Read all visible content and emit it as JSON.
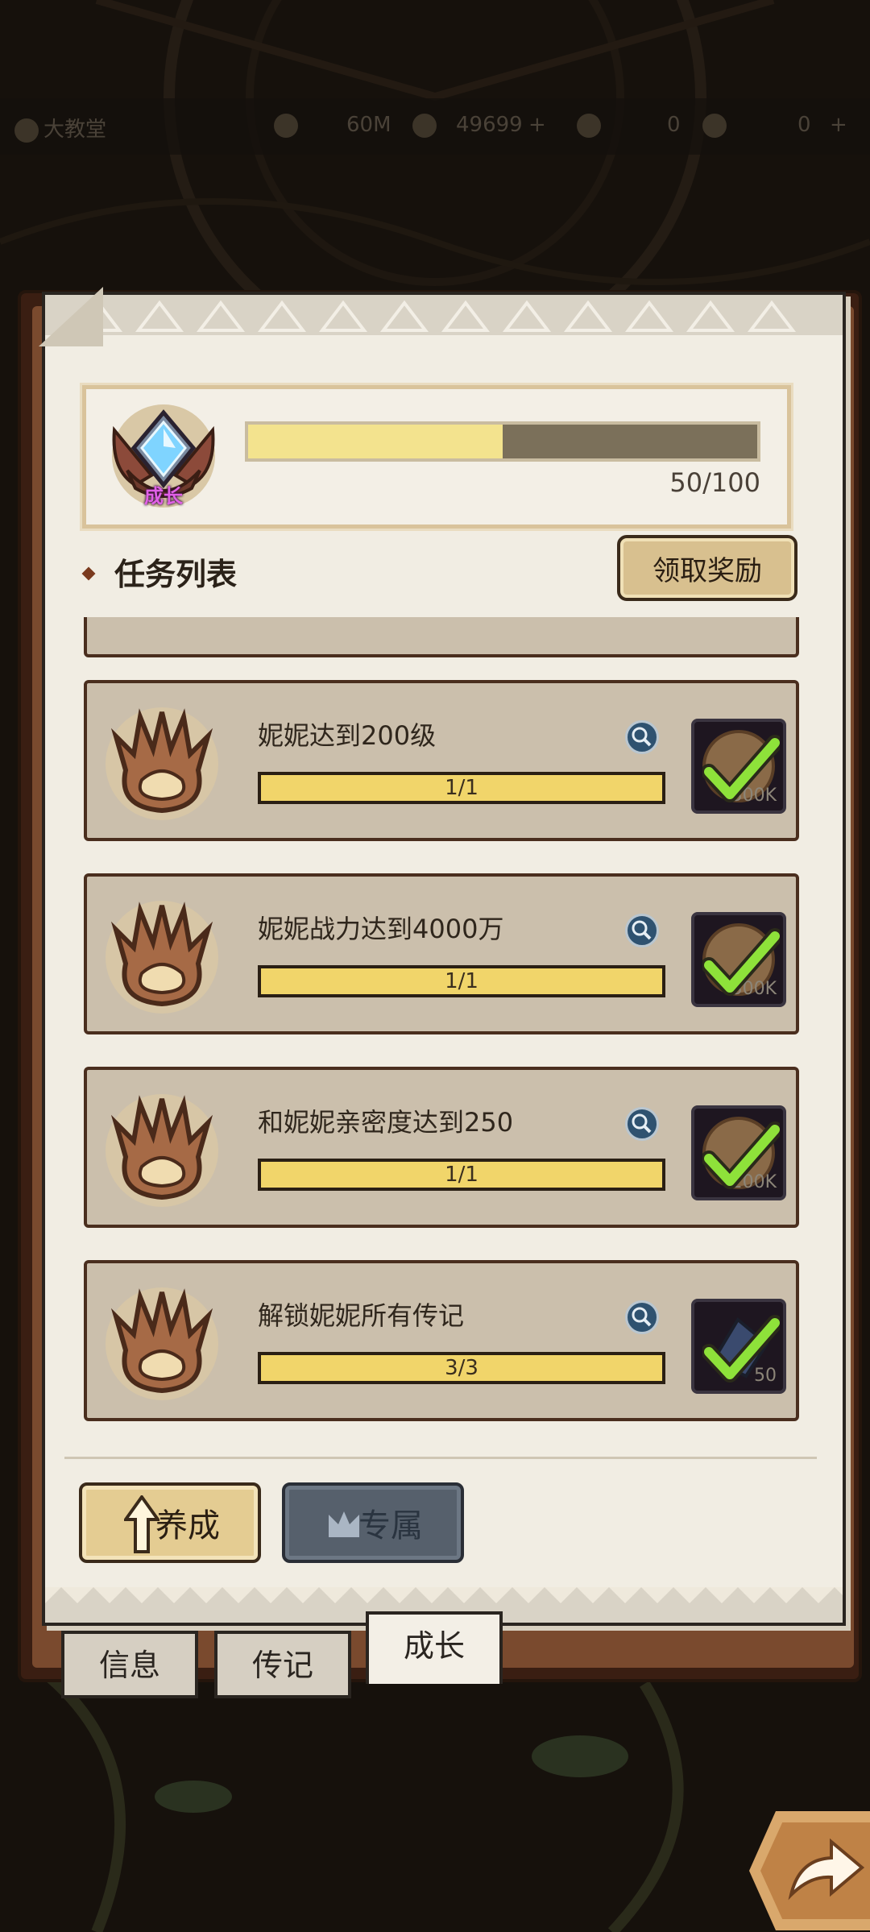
{
  "top_bar": {
    "location": "大教堂",
    "gold": "60M",
    "gems": "49699",
    "resource_a": "0",
    "resource_b": "0"
  },
  "growth": {
    "badge_label": "成长",
    "progress_value": 50,
    "progress_max": 100,
    "progress_text": "50/100"
  },
  "section_title": "任务列表",
  "claim_button": "领取奖励",
  "tasks": [
    {
      "name": "妮妮达到200级",
      "progress": "1/1",
      "reward_qty": "300K",
      "completed": true
    },
    {
      "name": "妮妮战力达到4000万",
      "progress": "1/1",
      "reward_qty": "300K",
      "completed": true
    },
    {
      "name": "和妮妮亲密度达到250",
      "progress": "1/1",
      "reward_qty": "200K",
      "completed": true
    },
    {
      "name": "解锁妮妮所有传记",
      "progress": "3/3",
      "reward_qty": "50",
      "completed": true
    }
  ],
  "nav_buttons": {
    "cultivate": "养成",
    "exclusive": "专属"
  },
  "tabs": {
    "info": "信息",
    "biography": "传记",
    "growth": "成长"
  },
  "colors": {
    "accent_fill": "#f3e38e",
    "task_bar": "#f1d56a",
    "check": "#8ee23a"
  }
}
